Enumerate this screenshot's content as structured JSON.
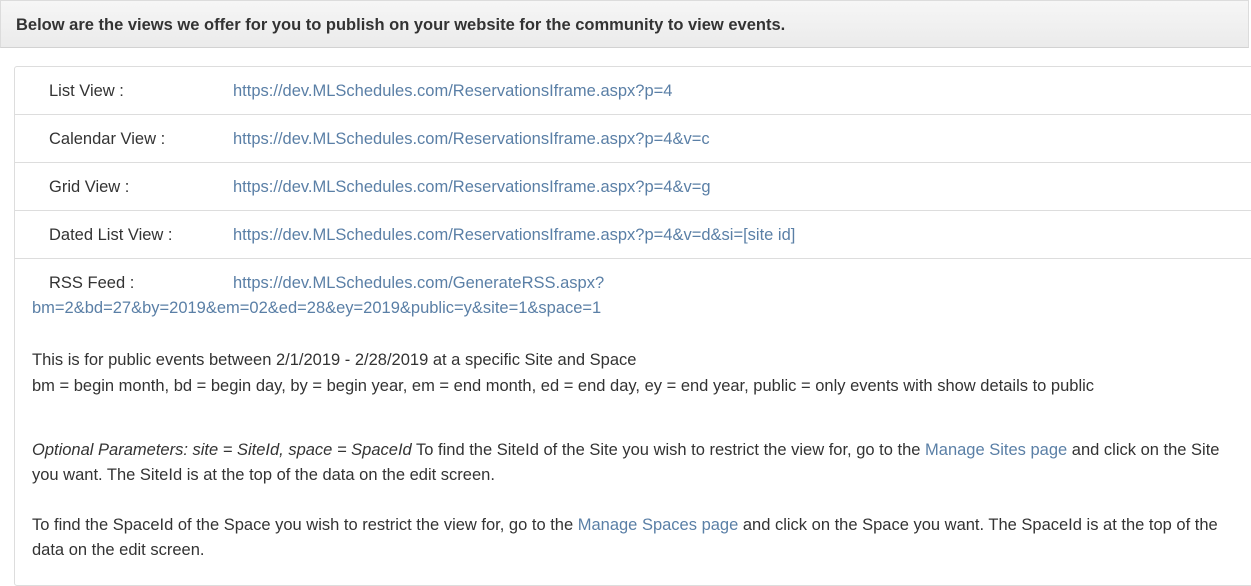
{
  "header": {
    "title": "Below are the views we offer for you to publish on your website for the community to view events."
  },
  "views": [
    {
      "label": "List View :",
      "url": "https://dev.MLSchedules.com/ReservationsIframe.aspx?p=4"
    },
    {
      "label": "Calendar View :",
      "url": "https://dev.MLSchedules.com/ReservationsIframe.aspx?p=4&v=c"
    },
    {
      "label": "Grid View :",
      "url": "https://dev.MLSchedules.com/ReservationsIframe.aspx?p=4&v=g"
    },
    {
      "label": "Dated List View :",
      "url": "https://dev.MLSchedules.com/ReservationsIframe.aspx?p=4&v=d&si=[site id]"
    }
  ],
  "rss": {
    "label": "RSS Feed :",
    "url_line1": "https://dev.MLSchedules.com/GenerateRSS.aspx?",
    "url_line2": "bm=2&bd=27&by=2019&em=02&ed=28&ey=2019&public=y&site=1&space=1"
  },
  "notes": {
    "public_events": "This is for public events between 2/1/2019 - 2/28/2019 at a specific Site and Space",
    "legend": "bm = begin month, bd = begin day, by = begin year, em = end month, ed = end day, ey = end year, public = only events with show details to public",
    "optional_params": "Optional Parameters: site = SiteId, space = SpaceId",
    "site_text_before": " To find the SiteId of the Site you wish to restrict the view for, go to the ",
    "site_link": "Manage Sites page",
    "site_text_after": " and click on the Site you want. The SiteId is at the top of the data on the edit screen.",
    "space_text_before": "To find the SpaceId of the Space you wish to restrict the view for, go to the ",
    "space_link": "Manage Spaces page",
    "space_text_after": " and click on the Space you want. The SpaceId is at the top of the data on the edit screen."
  },
  "colors": {
    "link": "#5a7fa6",
    "text": "#333333",
    "border": "#dddddd"
  }
}
